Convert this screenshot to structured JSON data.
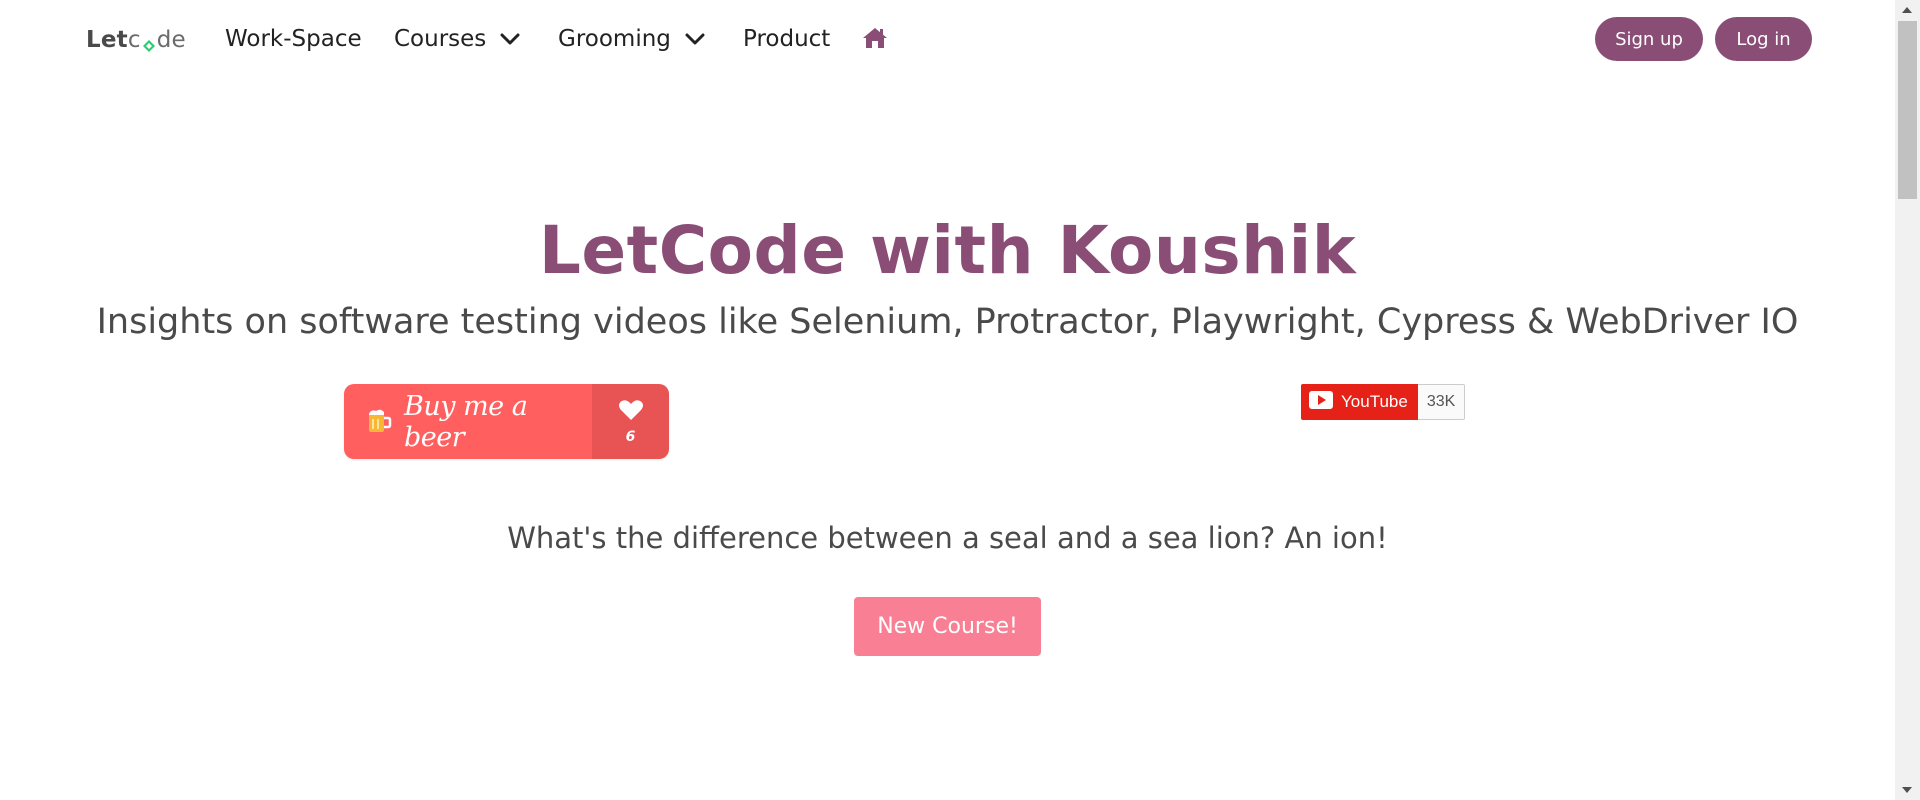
{
  "nav": {
    "logo_part1": "Let",
    "logo_part2": "c",
    "logo_part3": "de",
    "items": [
      {
        "label": "Work-Space"
      },
      {
        "label": "Courses"
      },
      {
        "label": "Grooming"
      },
      {
        "label": "Product"
      }
    ],
    "signup_label": "Sign up",
    "login_label": "Log in",
    "home_icon": "home-icon"
  },
  "hero": {
    "title": "LetCode with Koushik",
    "subtitle": "Insights on software testing videos like Selenium, Protractor, Playwright, Cypress & WebDriver IO"
  },
  "beer_button": {
    "label": "Buy me a beer",
    "count": "6"
  },
  "youtube": {
    "label": "YouTube",
    "count": "33K"
  },
  "joke": "What's the difference between a seal and a sea lion? An ion!",
  "cta": {
    "label": "New Course!"
  },
  "colors": {
    "brand": "#8a4d76",
    "beer": "#ff5f5f",
    "beer_count": "#e85353",
    "youtube": "#e62117",
    "cta": "#f97f94"
  }
}
